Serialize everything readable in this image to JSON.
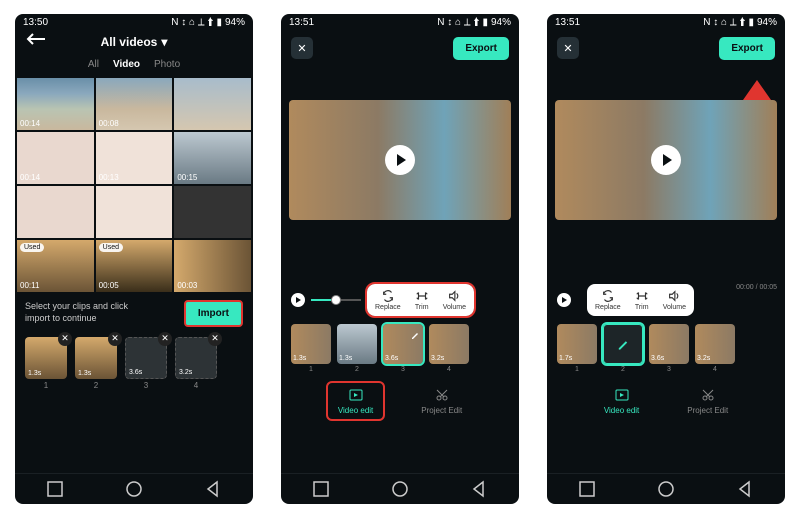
{
  "status": {
    "time1": "13:50",
    "time2": "13:51",
    "time3": "13:51",
    "badges": "N ↕ ⌂ ⟂ ⬆",
    "battery": "94%"
  },
  "screen1": {
    "title": "All videos",
    "tabs": {
      "all": "All",
      "video": "Video",
      "photo": "Photo"
    },
    "thumbs": [
      {
        "dur": "00:14"
      },
      {
        "dur": "00:08"
      },
      {
        "dur": ""
      },
      {
        "dur": "00:14"
      },
      {
        "dur": "00:13"
      },
      {
        "dur": "00:15"
      },
      {
        "dur": ""
      },
      {
        "dur": ""
      },
      {
        "dur": ""
      },
      {
        "dur": "00:11",
        "used": "Used"
      },
      {
        "dur": "00:05",
        "used": "Used"
      },
      {
        "dur": "00:03"
      }
    ],
    "import_message": "Select your clips and click import to continue",
    "import_btn": "Import",
    "selected": [
      {
        "dur": "1.3s",
        "idx": "1"
      },
      {
        "dur": "1.3s",
        "idx": "2"
      },
      {
        "dur": "3.6s",
        "idx": "3"
      },
      {
        "dur": "3.2s",
        "idx": "4"
      }
    ]
  },
  "screen2": {
    "export": "Export",
    "tools": {
      "replace": "Replace",
      "trim": "Trim",
      "volume": "Volume"
    },
    "clips": [
      {
        "dur": "1.3s",
        "idx": "1"
      },
      {
        "dur": "1.3s",
        "idx": "2"
      },
      {
        "dur": "3.6s",
        "idx": "3"
      },
      {
        "dur": "3.2s",
        "idx": "4"
      }
    ],
    "bottom_tabs": {
      "video_edit": "Video edit",
      "project_edit": "Project Edit"
    }
  },
  "screen3": {
    "export": "Export",
    "timecode": "00:00 / 00:05",
    "tools": {
      "replace": "Replace",
      "trim": "Trim",
      "volume": "Volume"
    },
    "clips": [
      {
        "dur": "1.7s",
        "idx": "1"
      },
      {
        "dur": "",
        "idx": "2"
      },
      {
        "dur": "3.6s",
        "idx": "3"
      },
      {
        "dur": "3.2s",
        "idx": "4"
      }
    ],
    "bottom_tabs": {
      "video_edit": "Video edit",
      "project_edit": "Project Edit"
    }
  }
}
